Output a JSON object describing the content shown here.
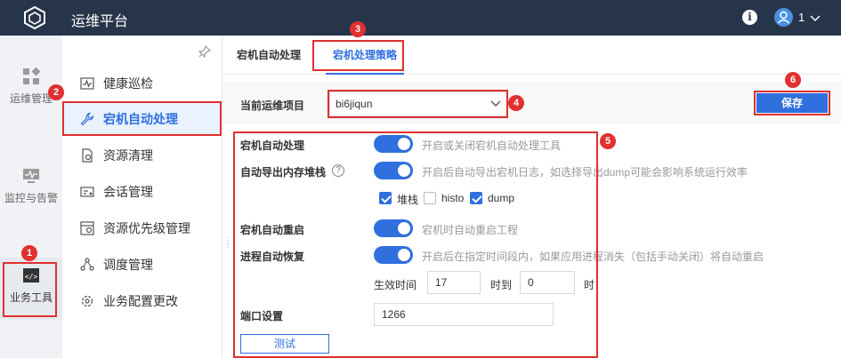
{
  "app": {
    "title": "运维平台",
    "user_name": "1"
  },
  "rail": {
    "items": [
      {
        "label": "运维管理",
        "icon": "grid-icon"
      },
      {
        "label": "监控与告警",
        "icon": "monitor-icon"
      },
      {
        "label": "业务工具",
        "icon": "code-icon"
      }
    ]
  },
  "submenu": {
    "items": [
      {
        "label": "健康巡检",
        "icon": "health-check-icon"
      },
      {
        "label": "宕机自动处理",
        "icon": "wrench-icon"
      },
      {
        "label": "资源清理",
        "icon": "clean-icon"
      },
      {
        "label": "会话管理",
        "icon": "session-icon"
      },
      {
        "label": "资源优先级管理",
        "icon": "priority-icon"
      },
      {
        "label": "调度管理",
        "icon": "schedule-icon"
      },
      {
        "label": "业务配置更改",
        "icon": "config-icon"
      }
    ]
  },
  "tabs": [
    {
      "label": "宕机自动处理"
    },
    {
      "label": "宕机处理策略"
    }
  ],
  "toolbar": {
    "project_label": "当前运维项目",
    "project_value": "bi6jiqun",
    "save_label": "保存"
  },
  "form": {
    "auto_handle": {
      "label": "宕机自动处理",
      "desc": "开启或关闭宕机自动处理工具"
    },
    "auto_dump": {
      "label": "自动导出内存堆栈",
      "desc": "开启后自动导出宕机日志，如选择导出dump可能会影响系统运行效率"
    },
    "checkboxes": [
      {
        "label": "堆栈",
        "checked": true
      },
      {
        "label": "histo",
        "checked": false
      },
      {
        "label": "dump",
        "checked": true
      }
    ],
    "auto_restart": {
      "label": "宕机自动重启",
      "desc": "宕机时自动重启工程"
    },
    "auto_recover": {
      "label": "进程自动恢复",
      "desc": "开启后在指定时间段内，如果应用进程消失（包括手动关闭）将自动重启"
    },
    "time_range": {
      "from_label": "生效时间",
      "from_value": "17",
      "to_label": "时到",
      "to_value": "0",
      "unit": "时"
    },
    "port": {
      "label": "端口设置",
      "value": "1266"
    },
    "test_label": "测试"
  },
  "annotations": [
    "1",
    "2",
    "3",
    "4",
    "5",
    "6"
  ],
  "colors": {
    "accent": "#2f6fde",
    "topbar": "#27354a",
    "annotation": "#e03030"
  }
}
